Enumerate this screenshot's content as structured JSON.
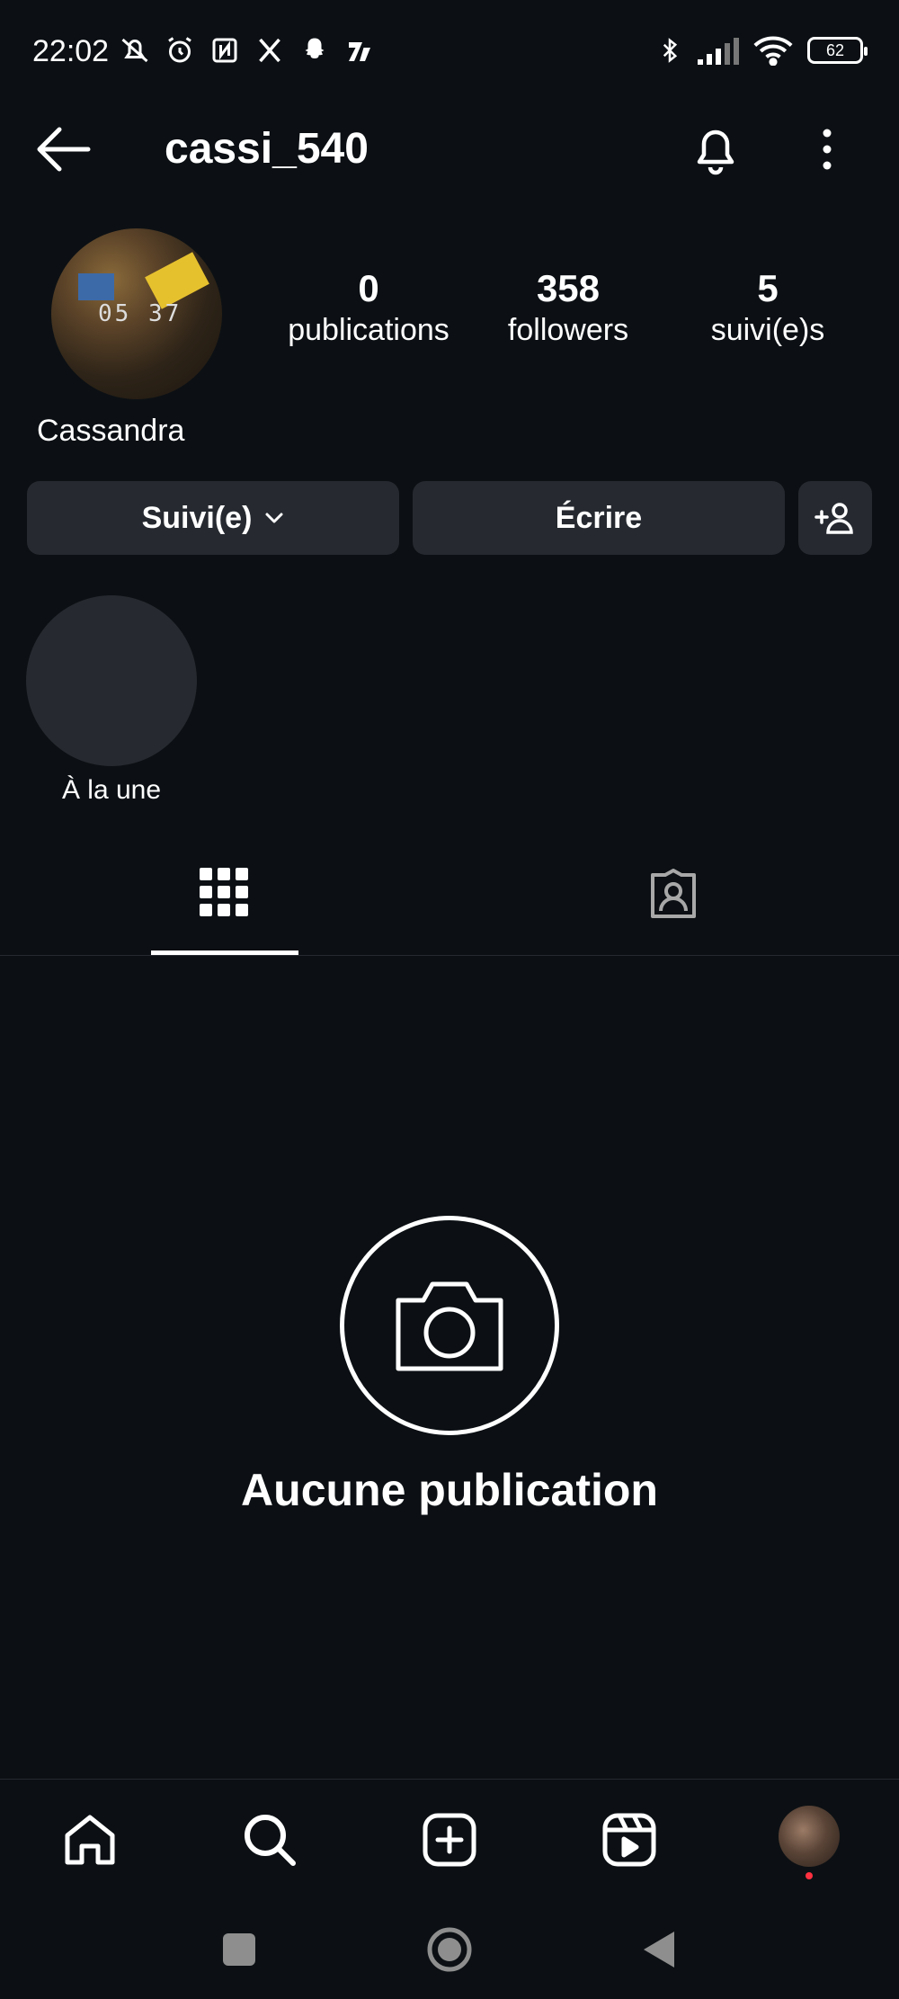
{
  "status_bar": {
    "time": "22:02",
    "battery": "62",
    "left_icons": [
      "silent-icon",
      "alarm-icon",
      "nfc-icon",
      "x-icon",
      "snapchat-icon",
      "zoom-app-icon"
    ],
    "right_icons": [
      "bluetooth-icon",
      "signal-icon",
      "wifi-icon",
      "battery-icon"
    ]
  },
  "header": {
    "username": "cassi_540"
  },
  "profile": {
    "display_name": "Cassandra",
    "avatar_text": "05 37",
    "stats": [
      {
        "value": "0",
        "label": "publications"
      },
      {
        "value": "358",
        "label": "followers"
      },
      {
        "value": "5",
        "label": "suivi(e)s"
      }
    ]
  },
  "actions": {
    "follow_label": "Suivi(e)",
    "write_label": "Écrire"
  },
  "highlights": [
    {
      "label": "À la une"
    }
  ],
  "tabs": {
    "active": "grid",
    "items": [
      "grid-icon",
      "tagged-icon"
    ]
  },
  "empty_state": {
    "title": "Aucune publication"
  },
  "bottom_nav": {
    "items": [
      "home-icon",
      "search-icon",
      "create-icon",
      "reels-icon",
      "profile-avatar"
    ]
  }
}
